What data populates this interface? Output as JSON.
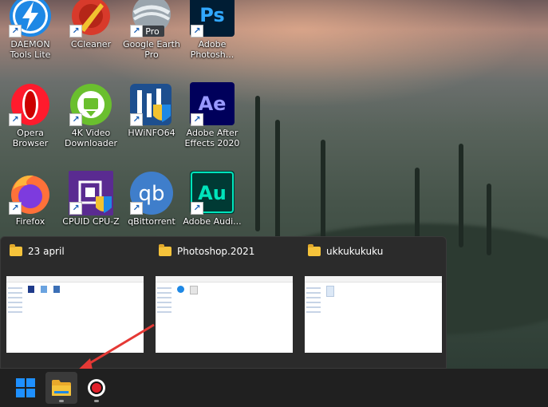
{
  "desktop": {
    "icons": [
      {
        "label": "DAEMON Tools Lite"
      },
      {
        "label": "CCleaner"
      },
      {
        "label": "Google Earth Pro",
        "badge": "Pro"
      },
      {
        "label": "Adobe Photosh...",
        "glyph": "Ps"
      },
      {
        "label": "Opera Browser"
      },
      {
        "label": "4K Video Downloader"
      },
      {
        "label": "HWiNFO64"
      },
      {
        "label": "Adobe After Effects 2020",
        "glyph": "Ae"
      },
      {
        "label": "Firefox"
      },
      {
        "label": "CPUID CPU-Z"
      },
      {
        "label": "qBittorrent",
        "glyph": "qb"
      },
      {
        "label": "Adobe Audi...",
        "glyph": "Au"
      }
    ]
  },
  "taskview": {
    "windows": [
      {
        "title": "23 april"
      },
      {
        "title": "Photoshop.2021"
      },
      {
        "title": "ukkukukuku"
      }
    ]
  },
  "taskbar": {
    "items": [
      {
        "name": "start-button"
      },
      {
        "name": "file-explorer-button",
        "active": true
      },
      {
        "name": "recorder-button"
      }
    ]
  },
  "colors": {
    "accent": "#1e90ff",
    "arrow": "#e53935",
    "folder": "#f5c33b"
  }
}
